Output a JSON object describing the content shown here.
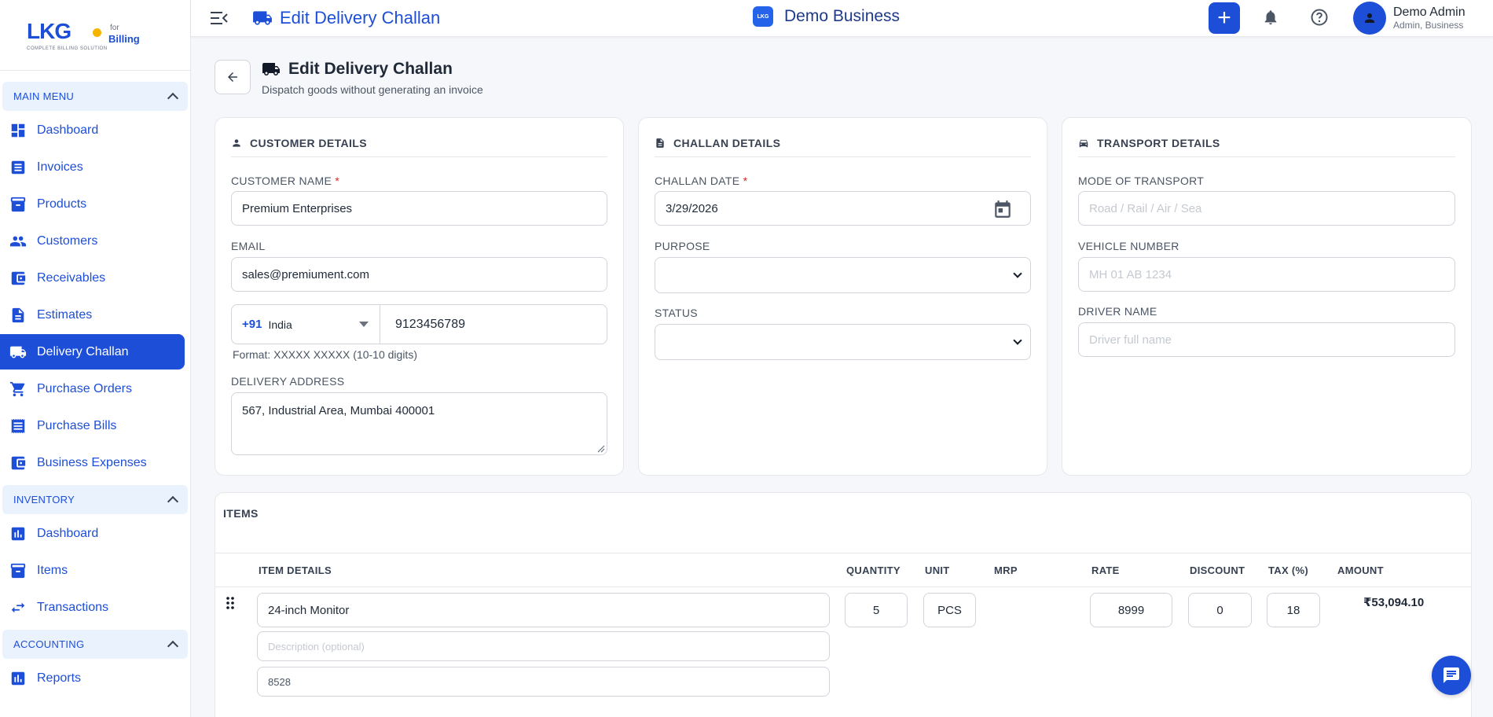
{
  "brand": {
    "logo_text": "LKG",
    "tagline": "COMPLETE BILLING SOLUTION",
    "for": "for",
    "product": "Billing"
  },
  "sidebar": {
    "main_menu": "MAIN MENU",
    "main_items": [
      {
        "label": "Dashboard",
        "icon": "dashboard-icon"
      },
      {
        "label": "Invoices",
        "icon": "invoice-icon"
      },
      {
        "label": "Products",
        "icon": "archive-icon"
      },
      {
        "label": "Customers",
        "icon": "people-icon"
      },
      {
        "label": "Receivables",
        "icon": "wallet-icon"
      },
      {
        "label": "Estimates",
        "icon": "document-icon"
      },
      {
        "label": "Delivery Challan",
        "icon": "truck-icon",
        "active": true
      },
      {
        "label": "Purchase Orders",
        "icon": "cart-icon"
      },
      {
        "label": "Purchase Bills",
        "icon": "receipt-icon"
      },
      {
        "label": "Business Expenses",
        "icon": "wallet-icon"
      }
    ],
    "inventory": "INVENTORY",
    "inventory_items": [
      {
        "label": "Dashboard",
        "icon": "chart-icon"
      },
      {
        "label": "Items",
        "icon": "archive-icon"
      },
      {
        "label": "Transactions",
        "icon": "swap-icon"
      }
    ],
    "accounting": "ACCOUNTING",
    "accounting_items": [
      {
        "label": "Reports",
        "icon": "bar-chart-icon"
      }
    ]
  },
  "topbar": {
    "title": "Edit Delivery Challan",
    "business": "Demo Business",
    "business_logo": "LKG",
    "user_name": "Demo Admin",
    "user_role": "Admin, Business"
  },
  "page": {
    "title": "Edit Delivery Challan",
    "subtitle": "Dispatch goods without generating an invoice"
  },
  "customer": {
    "heading": "CUSTOMER DETAILS",
    "name_label": "CUSTOMER NAME",
    "required": "*",
    "name_value": "Premium Enterprises",
    "email_label": "EMAIL",
    "email_value": "sales@premiument.com",
    "country_code": "+91",
    "country": "India",
    "phone_value": "9123456789",
    "phone_hint": "Format: XXXXX XXXXX (10-10 digits)",
    "address_label": "DELIVERY ADDRESS",
    "address_value": "567, Industrial Area, Mumbai 400001"
  },
  "challan": {
    "heading": "CHALLAN DETAILS",
    "date_label": "CHALLAN DATE",
    "required": "*",
    "date_value": "3/29/2026",
    "purpose_label": "PURPOSE",
    "purpose_value": "",
    "status_label": "STATUS",
    "status_value": ""
  },
  "transport": {
    "heading": "TRANSPORT DETAILS",
    "mode_label": "MODE OF TRANSPORT",
    "mode_placeholder": "Road / Rail / Air / Sea",
    "vehicle_label": "VEHICLE NUMBER",
    "vehicle_placeholder": "MH 01 AB 1234",
    "driver_label": "DRIVER NAME",
    "driver_placeholder": "Driver full name"
  },
  "items": {
    "heading": "ITEMS",
    "columns": [
      "ITEM DETAILS",
      "QUANTITY",
      "UNIT",
      "MRP",
      "RATE",
      "DISCOUNT",
      "TAX (%)",
      "AMOUNT"
    ],
    "rows": [
      {
        "name": "24-inch Monitor",
        "description_placeholder": "Description (optional)",
        "hsn": "8528",
        "quantity": "5",
        "unit": "PCS",
        "mrp": "",
        "rate": "8999",
        "discount": "0",
        "tax": "18",
        "amount": "₹53,094.10"
      }
    ]
  },
  "colors": {
    "primary": "#1d4ed8",
    "section_bg": "#eaf2fd",
    "required": "#dc2626"
  }
}
